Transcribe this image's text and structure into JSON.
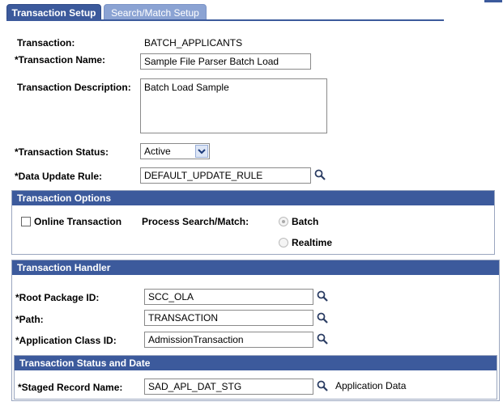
{
  "tabs": {
    "active": "Transaction Setup",
    "inactive": "Search/Match Setup"
  },
  "form": {
    "transaction_label": "Transaction:",
    "transaction_value": "BATCH_APPLICANTS",
    "name_label": "*Transaction Name:",
    "name_value": "Sample File Parser Batch Load",
    "description_label": "Transaction Description:",
    "description_value": "Batch Load Sample",
    "status_label": "*Transaction Status:",
    "status_value": "Active",
    "update_rule_label": "*Data Update Rule:",
    "update_rule_value": "DEFAULT_UPDATE_RULE"
  },
  "options": {
    "header": "Transaction Options",
    "online_label": "Online Transaction",
    "process_label": "Process Search/Match:",
    "radio_batch": "Batch",
    "radio_realtime": "Realtime"
  },
  "handler": {
    "header": "Transaction Handler",
    "root_label": "*Root Package ID:",
    "root_value": "SCC_OLA",
    "path_label": "*Path:",
    "path_value": "TRANSACTION",
    "class_label": "*Application Class ID:",
    "class_value": "AdmissionTransaction",
    "status_date_header": "Transaction Status and Date",
    "staged_label": "*Staged Record Name:",
    "staged_value": "SAD_APL_DAT_STG",
    "staged_desc": "Application Data"
  },
  "icons": {
    "lookup": "magnifier-icon",
    "dropdown": "chevron-down-icon"
  },
  "colors": {
    "header": "#3c5a9c",
    "tab_inactive": "#8ba3d3"
  }
}
